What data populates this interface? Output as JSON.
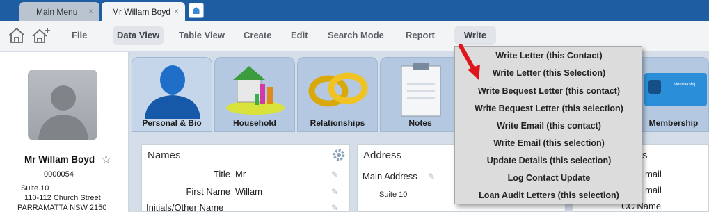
{
  "tabs": [
    {
      "label": "Main Menu",
      "close": "×"
    },
    {
      "label": "Mr Willam Boyd",
      "close": "×"
    }
  ],
  "menu": {
    "file": "File",
    "data_view": "Data View",
    "table_view": "Table View",
    "create": "Create",
    "edit": "Edit",
    "search_mode": "Search Mode",
    "report": "Report",
    "write": "Write"
  },
  "contact": {
    "name": "Mr Willam Boyd",
    "star": "☆",
    "number": "0000054",
    "address": [
      "Suite 10",
      "110-112 Church Street",
      "PARRAMATTA NSW 2150"
    ]
  },
  "tiles": [
    {
      "label": "Personal & Bio"
    },
    {
      "label": "Household"
    },
    {
      "label": "Relationships"
    },
    {
      "label": "Notes"
    },
    {
      "label": "Membership"
    }
  ],
  "membership_card_text": "Membership",
  "names_panel": {
    "title": "Names",
    "fields": [
      {
        "label": "Title",
        "value": "Mr"
      },
      {
        "label": "First Name",
        "value": "Willam"
      },
      {
        "label": "Initials/Other Name",
        "value": ""
      }
    ]
  },
  "address_panel": {
    "title": "Address",
    "main_label": "Main Address",
    "line": "Suite 10"
  },
  "right_panel": {
    "title_partial": "s",
    "items": [
      "mail",
      "mail",
      "CC Name"
    ]
  },
  "write_menu": {
    "items": [
      "Write Letter (this Contact)",
      "Write Letter (this Selection)",
      "Write Bequest Letter (this contact)",
      "Write Bequest Letter (this selection)",
      "Write Email (this contact)",
      "Write Email (this selection)",
      "Update Details (this selection)",
      "Log Contact Update",
      "Loan Audit Letters (this selection)"
    ]
  },
  "colors": {
    "tabstrip": "#1f5da3",
    "tile": "#b4c9e1",
    "arrow": "#e0141b"
  }
}
